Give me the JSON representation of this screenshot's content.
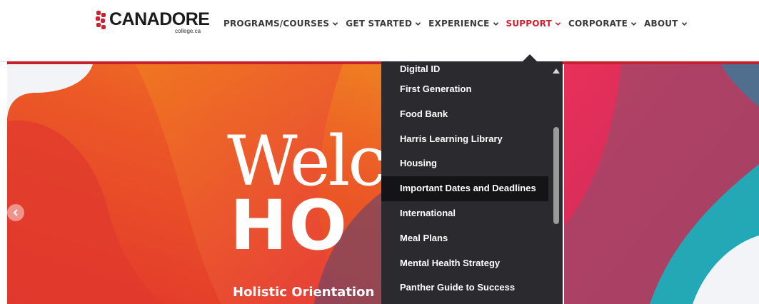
{
  "header": {
    "logo_text": "CANADORE",
    "logo_subtext": "college.ca",
    "brand_color": "#d0202e",
    "nav": [
      {
        "label": "PROGRAMS/COURSES",
        "active": false
      },
      {
        "label": "GET STARTED",
        "active": false
      },
      {
        "label": "EXPERIENCE",
        "active": false
      },
      {
        "label": "SUPPORT",
        "active": true
      },
      {
        "label": "CORPORATE",
        "active": false
      },
      {
        "label": "ABOUT",
        "active": false
      }
    ]
  },
  "hero": {
    "headline_line1": "Welc",
    "headline_line2": "HO",
    "subheadline": "Holistic Orientation",
    "prev_icon": "chevron-left-icon"
  },
  "support_menu": {
    "items": [
      "Digital ID",
      "First Generation",
      "Food Bank",
      "Harris Learning Library",
      "Housing",
      "Important Dates and Deadlines",
      "International",
      "Meal Plans",
      "Mental Health Strategy",
      "Panther Guide to Success"
    ],
    "highlighted_item": "Important Dates and Deadlines",
    "background_color": "#2b2b2f",
    "highlight_color": "#141416"
  }
}
